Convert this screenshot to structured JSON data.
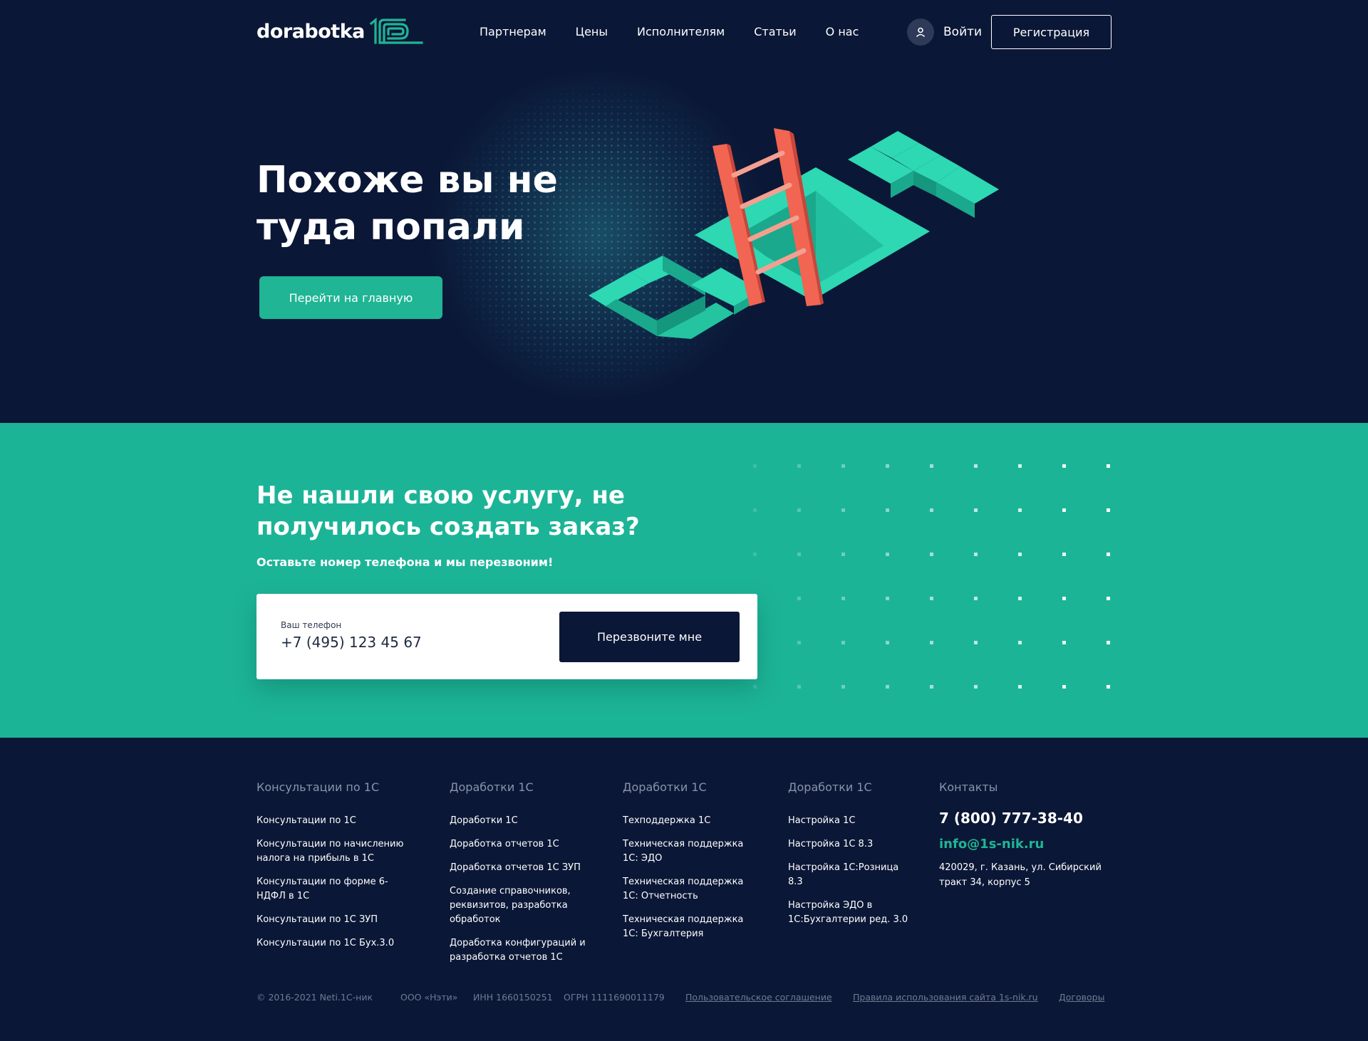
{
  "header": {
    "logo_text": "dorabotka",
    "nav": [
      "Партнерам",
      "Цены",
      "Исполнителям",
      "Статьи",
      "О нас"
    ],
    "login_label": "Войти",
    "register_label": "Регистрация"
  },
  "hero": {
    "title": "Похоже вы не туда попали",
    "button_label": "Перейти на главную"
  },
  "callback": {
    "title": "Не нашли свою услугу, не получилось создать заказ?",
    "subtitle": "Оставьте номер телефона и мы перезвоним!",
    "phone_label": "Ваш телефон",
    "phone_value": "+7 (495) 123 45 67",
    "button_label": "Перезвоните мне"
  },
  "footer": {
    "columns": [
      {
        "title": "Консультации по 1С",
        "items": [
          "Консультации по 1С",
          "Консультации по начислению налога на прибыль в 1С",
          "Консультации по форме 6-НДФЛ в 1С",
          "Консультации по 1С ЗУП",
          "Консультации по 1С Бух.3.0"
        ]
      },
      {
        "title": "Доработки 1С",
        "items": [
          "Доработки 1С",
          "Доработка отчетов 1С",
          "Доработка отчетов 1С ЗУП",
          "Создание справочников, реквизитов, разработка обработок",
          "Доработка конфигураций и разработка отчетов 1С"
        ]
      },
      {
        "title": "Доработки 1С",
        "items": [
          "Техподдержка 1С",
          "Техническая поддержка 1С: ЭДО",
          "Техническая поддержка 1С: Отчетность",
          "Техническая поддержка 1С: Бухгалтерия"
        ]
      },
      {
        "title": "Доработки 1С",
        "items": [
          "Настройка 1С",
          "Настройка 1С 8.3",
          "Настройка 1С:Розница 8.3",
          "Настройка ЭДО в 1С:Бухгалтерии ред. 3.0"
        ]
      }
    ],
    "contacts": {
      "title": "Контакты",
      "phone": "7 (800) 777-38-40",
      "email": "info@1s-nik.ru",
      "address": "420029, г. Казань, ул. Сибирский тракт 34, корпус 5"
    },
    "bottom": {
      "copyright": "© 2016-2021 Neti.1C-ник",
      "company": "ООО «Нэти»",
      "inn": "ИНН 1660150251",
      "ogrn": "ОГРН 1111690011179",
      "agreement": "Пользовательское соглашение",
      "rules": "Правила использования сайта 1s-nik.ru",
      "contracts": "Договоры"
    }
  },
  "colors": {
    "background_dark": "#0b1736",
    "accent_green": "#1cb497",
    "ladder_red": "#f26552"
  }
}
